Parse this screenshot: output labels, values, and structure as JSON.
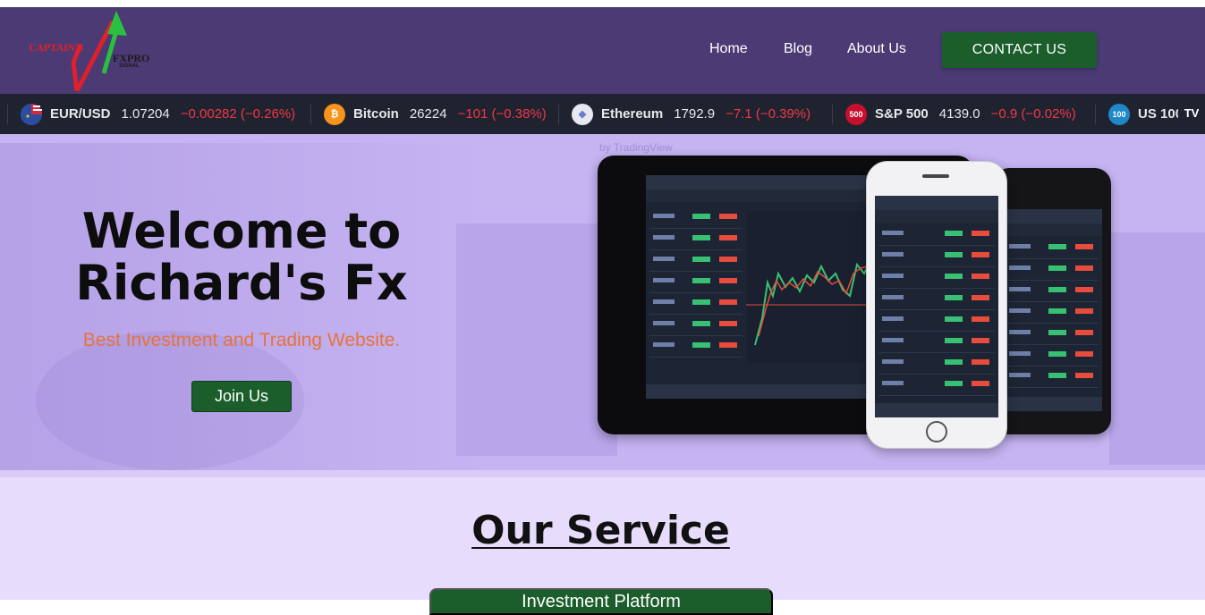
{
  "brand": {
    "logo_line1": "CAPTAIN'S",
    "logo_line2": "FXPRO",
    "logo_line3": "SIGNAL"
  },
  "nav": {
    "items": [
      {
        "label": "Home"
      },
      {
        "label": "Blog"
      },
      {
        "label": "About Us"
      }
    ],
    "contact_label": "CONTACT US"
  },
  "ticker": {
    "items": [
      {
        "name": "EUR/USD",
        "price": "1.07204",
        "change": "−0.00282 (−0.26%)",
        "icon": "eu-us-flag-icon",
        "icon_text": "",
        "color": "#2a5caa"
      },
      {
        "name": "Bitcoin",
        "price": "26224",
        "change": "−101 (−0.38%)",
        "icon": "bitcoin-icon",
        "icon_text": "₿",
        "color": "#f7931a"
      },
      {
        "name": "Ethereum",
        "price": "1792.9",
        "change": "−7.1 (−0.39%)",
        "icon": "ethereum-icon",
        "icon_text": "◆",
        "color": "#e8e8f0"
      },
      {
        "name": "S&P 500",
        "price": "4139.0",
        "change": "−0.9 (−0.02%)",
        "icon": "sp500-icon",
        "icon_text": "500",
        "color": "#c8102e"
      },
      {
        "name": "US 100",
        "price": "",
        "change": "",
        "icon": "us100-icon",
        "icon_text": "100",
        "color": "#1e88c8"
      }
    ],
    "watermark": "by TradingView",
    "tv_logo": "TV"
  },
  "hero": {
    "title": "Welcome to Richard's Fx",
    "subtitle": "Best Investment and Trading Website.",
    "join_label": "Join Us"
  },
  "service": {
    "title": "Our Service",
    "button_label": "Investment Platform"
  },
  "colors": {
    "nav_bg": "#4b3a74",
    "hero_bg": "#c6b3f2",
    "accent_green": "#1b5e2b",
    "ticker_bg": "#1f2330",
    "negative": "#f23645",
    "subtitle": "#e8733a",
    "service_bg": "#e7dcfc"
  }
}
